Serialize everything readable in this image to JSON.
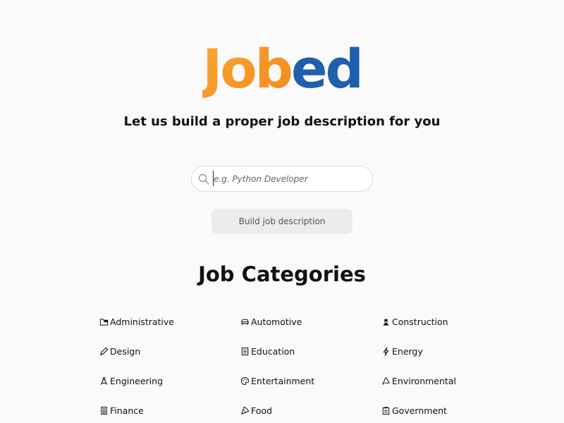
{
  "brand": {
    "part1": "Job",
    "part2": "ed"
  },
  "tagline": "Let us build a proper job description for you",
  "search": {
    "placeholder": "e.g. Python Developer",
    "value": "",
    "icon": "search-icon"
  },
  "build_button": "Build job description",
  "categories_title": "Job Categories",
  "categories": [
    {
      "label": "Administrative",
      "icon": "folder-icon"
    },
    {
      "label": "Automotive",
      "icon": "car-icon"
    },
    {
      "label": "Construction",
      "icon": "worker-icon"
    },
    {
      "label": "Design",
      "icon": "pencil-icon"
    },
    {
      "label": "Education",
      "icon": "book-icon"
    },
    {
      "label": "Energy",
      "icon": "lightning-icon"
    },
    {
      "label": "Engineering",
      "icon": "compass-icon"
    },
    {
      "label": "Entertainment",
      "icon": "palette-icon"
    },
    {
      "label": "Environmental",
      "icon": "recycle-icon"
    },
    {
      "label": "Finance",
      "icon": "calculator-icon"
    },
    {
      "label": "Food",
      "icon": "pizza-icon"
    },
    {
      "label": "Government",
      "icon": "clipboard-icon"
    }
  ],
  "colors": {
    "brand_orange": "#f48a1f",
    "brand_blue": "#1f5fad",
    "background": "#fafafa"
  }
}
